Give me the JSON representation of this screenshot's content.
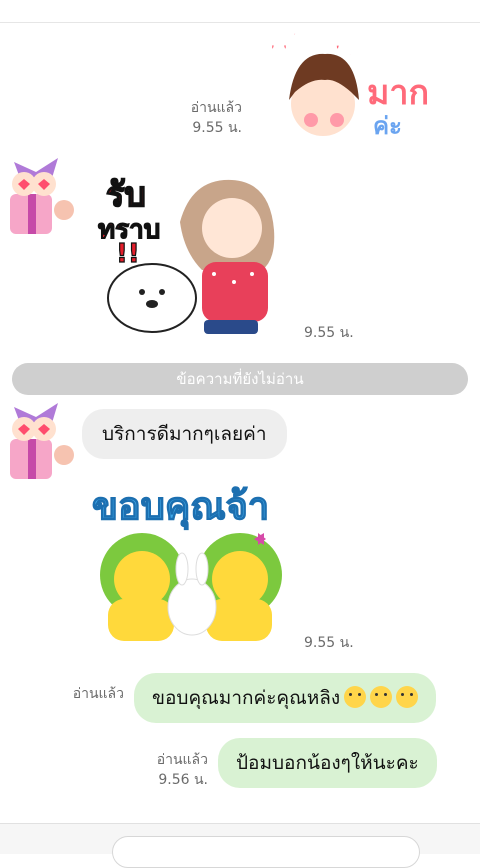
{
  "messages": {
    "m1": {
      "read_label": "อ่านแล้ว",
      "time": "9.55 น.",
      "sticker_text_1": "พระคุณ",
      "sticker_text_2": "มาก",
      "sticker_text_3": "ค่ะ"
    },
    "m2": {
      "time": "9.55 น.",
      "sticker_text_1": "รับ",
      "sticker_text_2": "ทราบ",
      "sticker_text_3": "!!"
    },
    "unread_divider": "ข้อความที่ยังไม่อ่าน",
    "m3": {
      "text": "บริการดีมากๆเลยค่า"
    },
    "m4": {
      "time": "9.55 น.",
      "sticker_text": "ขอบคุณจ้า"
    },
    "m5": {
      "read_label": "อ่านแล้ว",
      "text": "ขอบคุณมากค่ะคุณหลิง"
    },
    "m6": {
      "read_label": "อ่านแล้ว",
      "time": "9.56 น.",
      "text": "ป้อมบอกน้องๆให้นะคะ"
    }
  },
  "icons": {
    "avatar_1": "gift-avatar",
    "avatar_2": "gift-avatar",
    "emoji_count": 3
  },
  "colors": {
    "outgoing_bubble": "#d9f2d3",
    "incoming_bubble": "#eeeeee",
    "divider": "#cfcfcf"
  }
}
